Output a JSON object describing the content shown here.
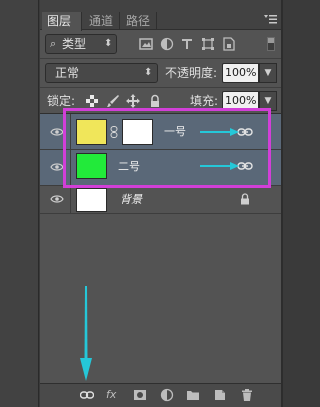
{
  "tabs": [
    {
      "label": "图层"
    },
    {
      "label": "通道"
    },
    {
      "label": "路径"
    }
  ],
  "filter": {
    "kind_label": "类型"
  },
  "blend": {
    "mode_label": "正常",
    "opacity_label": "不透明度:",
    "opacity_value": "100%"
  },
  "lock": {
    "label": "锁定:",
    "fill_label": "填充:",
    "fill_value": "100%"
  },
  "layers": [
    {
      "name": "一号",
      "thumb_color": "#f0e65a",
      "has_mask": true,
      "linked": true,
      "selected": true
    },
    {
      "name": "二号",
      "thumb_color": "#22ea3a",
      "has_mask": false,
      "linked": true,
      "selected": true
    },
    {
      "name": "背景",
      "thumb_color": "#ffffff",
      "locked": true,
      "selected": false
    }
  ],
  "bottom_bar": {
    "fx_label": "fx"
  },
  "colors": {
    "panel_bg": "#535353",
    "selected_row": "#5a6878",
    "highlight_border": "#d23fd8",
    "arrow": "#25c7d8"
  },
  "icons": [
    "search-icon",
    "chevron-down-icon",
    "image-icon",
    "circle-half-icon",
    "text-icon",
    "transform-icon",
    "smart-object-icon",
    "checkerboard-icon",
    "brush-icon",
    "move-icon",
    "lock-icon",
    "eye-icon",
    "link-icon",
    "fx-icon",
    "mask-icon",
    "adjustment-icon",
    "folder-icon",
    "new-layer-icon",
    "trash-icon",
    "panel-menu-icon"
  ]
}
